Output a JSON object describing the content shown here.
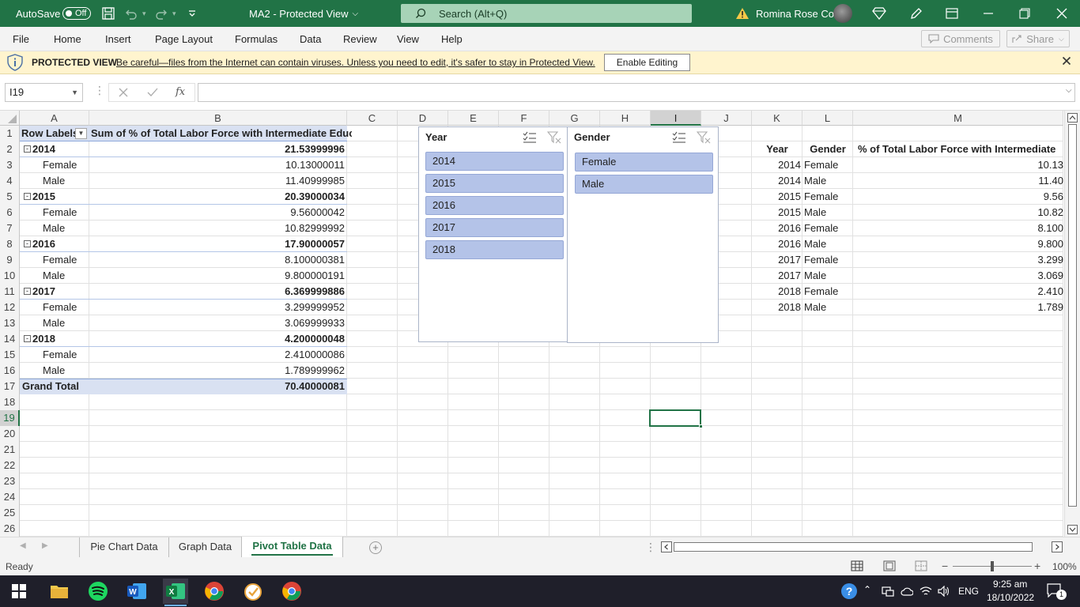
{
  "titlebar": {
    "autosave_label": "AutoSave",
    "autosave_state": "Off",
    "doc_title": "MA2  -  Protected View",
    "search_placeholder": "Search (Alt+Q)",
    "user_name": "Romina Rose Co"
  },
  "menu": {
    "items": [
      "File",
      "Home",
      "Insert",
      "Page Layout",
      "Formulas",
      "Data",
      "Review",
      "View",
      "Help"
    ],
    "comments_label": "Comments",
    "share_label": "Share"
  },
  "protected": {
    "title": "PROTECTED VIEW",
    "message": "Be careful—files from the Internet can contain viruses. Unless you need to edit, it's safer to stay in Protected View.",
    "enable_label": "Enable Editing"
  },
  "formula_bar": {
    "name_box": "I19",
    "fx": "fx",
    "formula": ""
  },
  "columns": [
    "A",
    "B",
    "C",
    "D",
    "E",
    "F",
    "G",
    "H",
    "I",
    "J",
    "K",
    "L",
    "M"
  ],
  "rows": [
    "1",
    "2",
    "3",
    "4",
    "5",
    "6",
    "7",
    "8",
    "9",
    "10",
    "11",
    "12",
    "13",
    "14",
    "15",
    "16",
    "17",
    "18",
    "19",
    "20",
    "21",
    "22",
    "23",
    "24",
    "25",
    "26"
  ],
  "pivot": {
    "row_labels_header": "Row Labels",
    "value_header": "Sum of % of Total Labor Force with Intermediate Educ",
    "rows": [
      {
        "label": "2014",
        "value": "21.53999996",
        "kind": "year"
      },
      {
        "label": "Female",
        "value": "10.13000011",
        "kind": "item"
      },
      {
        "label": "Male",
        "value": "11.40999985",
        "kind": "item"
      },
      {
        "label": "2015",
        "value": "20.39000034",
        "kind": "year"
      },
      {
        "label": "Female",
        "value": "9.56000042",
        "kind": "item"
      },
      {
        "label": "Male",
        "value": "10.82999992",
        "kind": "item"
      },
      {
        "label": "2016",
        "value": "17.90000057",
        "kind": "year"
      },
      {
        "label": "Female",
        "value": "8.100000381",
        "kind": "item"
      },
      {
        "label": "Male",
        "value": "9.800000191",
        "kind": "item"
      },
      {
        "label": "2017",
        "value": "6.369999886",
        "kind": "year"
      },
      {
        "label": "Female",
        "value": "3.299999952",
        "kind": "item"
      },
      {
        "label": "Male",
        "value": "3.069999933",
        "kind": "item"
      },
      {
        "label": "2018",
        "value": "4.200000048",
        "kind": "year"
      },
      {
        "label": "Female",
        "value": "2.410000086",
        "kind": "item"
      },
      {
        "label": "Male",
        "value": "1.789999962",
        "kind": "item"
      }
    ],
    "grand_total_label": "Grand Total",
    "grand_total_value": "70.40000081"
  },
  "slicers": {
    "year": {
      "title": "Year",
      "items": [
        "2014",
        "2015",
        "2016",
        "2017",
        "2018"
      ]
    },
    "gender": {
      "title": "Gender",
      "items": [
        "Female",
        "Male"
      ]
    }
  },
  "source_table": {
    "headers": [
      "Year",
      "Gender",
      "% of Total Labor Force with Intermediate"
    ],
    "rows": [
      [
        "2014",
        "Female",
        "10.13"
      ],
      [
        "2014",
        "Male",
        "11.40"
      ],
      [
        "2015",
        "Female",
        "9.56"
      ],
      [
        "2015",
        "Male",
        "10.82"
      ],
      [
        "2016",
        "Female",
        "8.100"
      ],
      [
        "2016",
        "Male",
        "9.800"
      ],
      [
        "2017",
        "Female",
        "3.299"
      ],
      [
        "2017",
        "Male",
        "3.069"
      ],
      [
        "2018",
        "Female",
        "2.410"
      ],
      [
        "2018",
        "Male",
        "1.789"
      ]
    ]
  },
  "sheet_tabs": [
    "Pie Chart Data",
    "Graph Data",
    "Pivot Table Data"
  ],
  "active_sheet": "Pivot Table Data",
  "status": {
    "ready": "Ready",
    "zoom": "100%"
  },
  "taskbar": {
    "lang": "ENG",
    "time": "9:25 am",
    "date": "18/10/2022",
    "notifications": "1"
  },
  "colors": {
    "excel_green": "#217346",
    "pivot_header_fill": "#d9e1f2",
    "slicer_item": "#b4c3e8",
    "protected_bar": "#fff4ce"
  }
}
